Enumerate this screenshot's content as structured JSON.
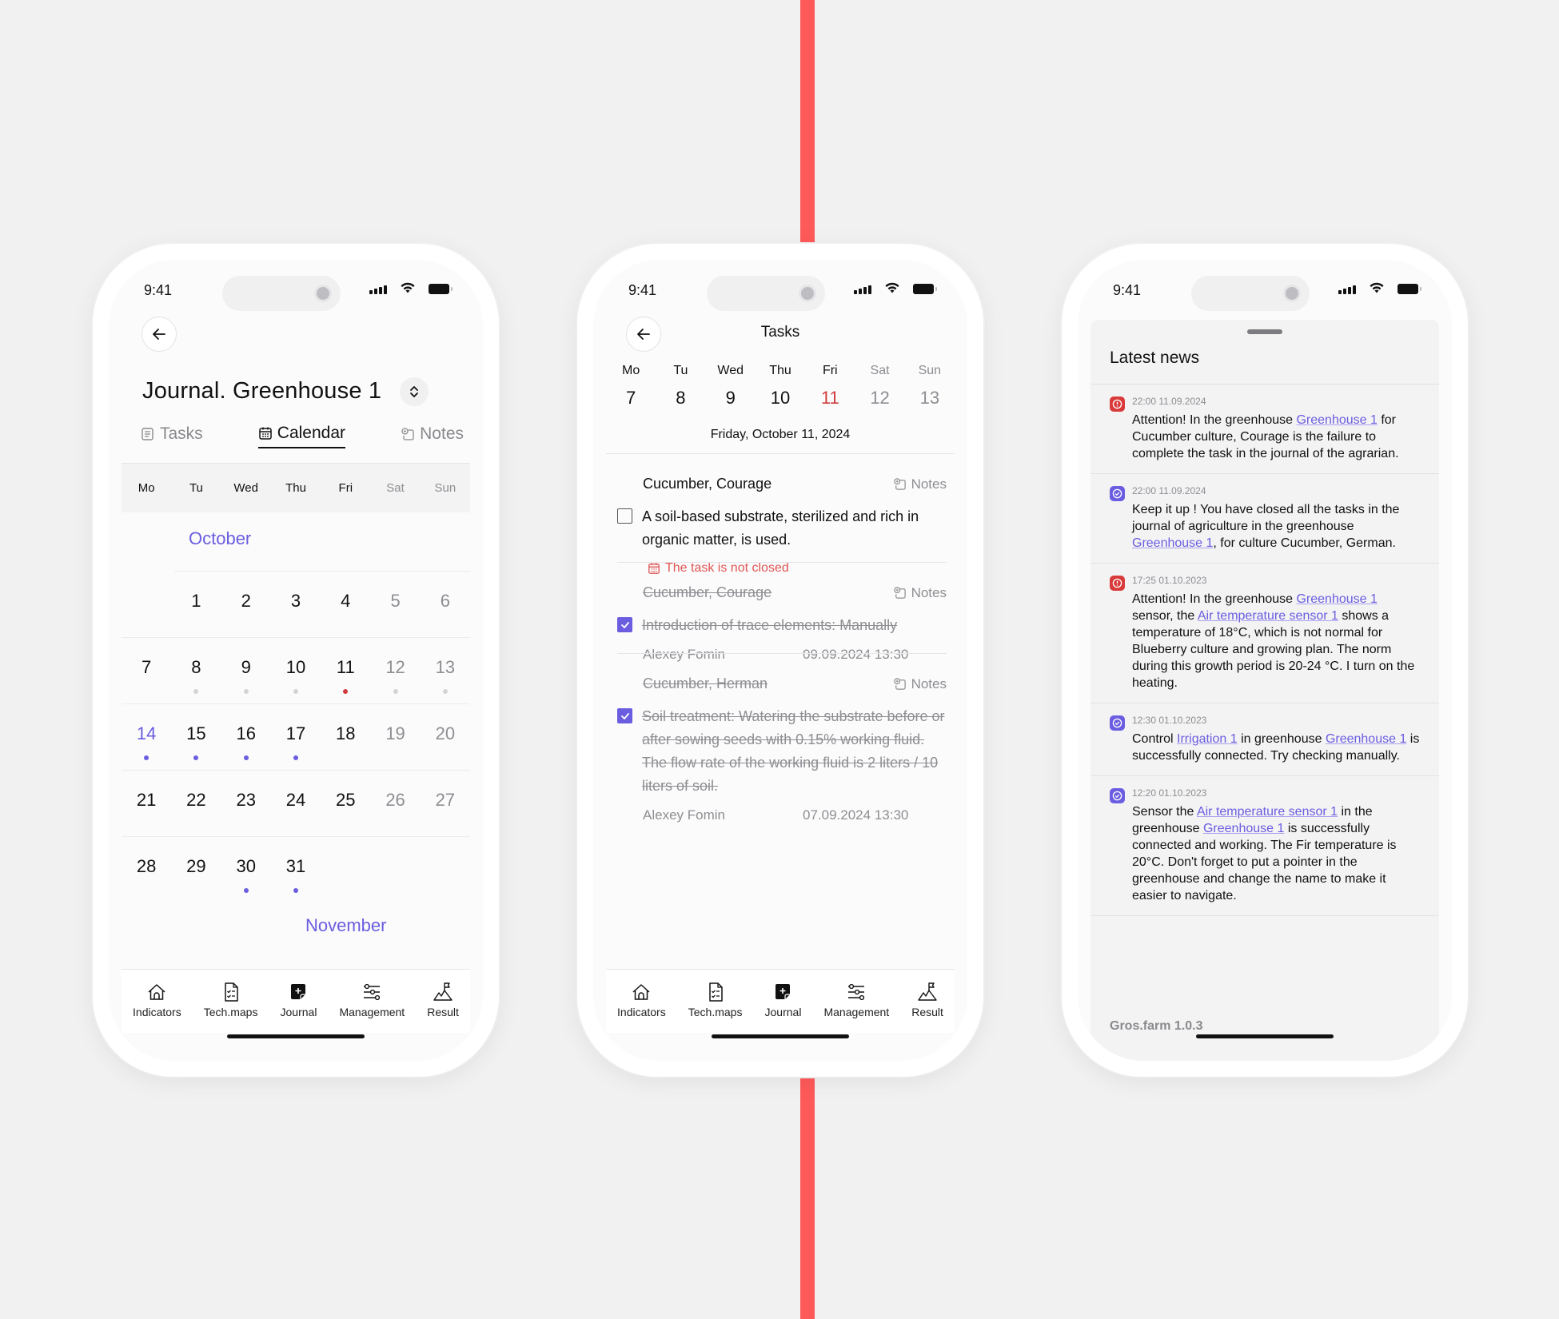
{
  "status_bar": {
    "time": "9:41"
  },
  "phone1": {
    "title": "Journal. Greenhouse 1",
    "tabs": [
      {
        "label": "Tasks",
        "icon": "list-icon",
        "active": false
      },
      {
        "label": "Calendar",
        "icon": "calendar-icon",
        "active": true
      },
      {
        "label": "Notes",
        "icon": "notes-icon",
        "active": false
      }
    ],
    "weekdays": [
      "Mo",
      "Tu",
      "Wed",
      "Thu",
      "Fri",
      "Sat",
      "Sun"
    ],
    "month": "October",
    "next_month": "November",
    "weeks": [
      [
        null,
        1,
        2,
        3,
        4,
        5,
        6
      ],
      [
        7,
        8,
        9,
        10,
        11,
        12,
        13
      ],
      [
        14,
        15,
        16,
        17,
        18,
        19,
        20
      ],
      [
        21,
        22,
        23,
        24,
        25,
        26,
        27
      ],
      [
        28,
        29,
        30,
        31,
        null,
        null,
        null
      ]
    ],
    "today": 14,
    "dots": {
      "8": "gray",
      "9": "gray",
      "10": "gray",
      "11": "red",
      "12": "gray",
      "13": "gray",
      "14": "purple",
      "15": "purple",
      "16": "purple",
      "17": "purple",
      "30": "purple",
      "31": "purple"
    }
  },
  "tabbar": [
    {
      "label": "Indicators",
      "icon": "home-icon"
    },
    {
      "label": "Tech.maps",
      "icon": "document-checklist-icon"
    },
    {
      "label": "Journal",
      "icon": "journal-add-icon"
    },
    {
      "label": "Management",
      "icon": "sliders-icon"
    },
    {
      "label": "Result",
      "icon": "mountain-flag-icon"
    }
  ],
  "phone2": {
    "title": "Tasks",
    "week": [
      {
        "name": "Mo",
        "day": "7"
      },
      {
        "name": "Tu",
        "day": "8"
      },
      {
        "name": "Wed",
        "day": "9"
      },
      {
        "name": "Thu",
        "day": "10"
      },
      {
        "name": "Fri",
        "day": "11",
        "selected": true
      },
      {
        "name": "Sat",
        "day": "12",
        "weekend": true
      },
      {
        "name": "Sun",
        "day": "13",
        "weekend": true
      }
    ],
    "date_label": "Friday, October 11, 2024",
    "notes_label": "Notes",
    "tasks": [
      {
        "culture": "Cucumber, Courage",
        "text": "A soil-based substrate, sterilized and rich in organic matter, is used.",
        "done": false,
        "warning": "The task is not closed"
      },
      {
        "culture": "Cucumber, Courage",
        "text": "Introduction of trace elements: Manually",
        "done": true,
        "author": "Alexey Fomin",
        "datetime": "09.09.2024 13:30"
      },
      {
        "culture": "Cucumber, Herman",
        "text": "Soil treatment: Watering the substrate before or after sowing seeds with 0.15% working fluid. The flow rate of the working fluid is 2 liters / 10 liters of soil.",
        "done": true,
        "author": "Alexey Fomin",
        "datetime": "07.09.2024 13:30"
      }
    ]
  },
  "phone3": {
    "title": "Latest news",
    "news": [
      {
        "type": "alert",
        "timestamp": "22:00 11.09.2024",
        "parts": [
          {
            "t": "Attention! In the greenhouse "
          },
          {
            "link": "Greenhouse 1"
          },
          {
            "t": " for Cucumber culture, Courage is the failure to complete the task in the journal of the agrarian."
          }
        ]
      },
      {
        "type": "ok",
        "timestamp": "22:00 11.09.2024",
        "parts": [
          {
            "t": "Keep it up ! You have closed all the tasks in the journal of agriculture in the greenhouse "
          },
          {
            "link": "Greenhouse 1"
          },
          {
            "t": ", for culture Cucumber, German."
          }
        ]
      },
      {
        "type": "alert",
        "timestamp": "17:25 01.10.2023",
        "parts": [
          {
            "t": "Attention! In the greenhouse "
          },
          {
            "link": "Greenhouse 1"
          },
          {
            "t": " sensor, the "
          },
          {
            "link": "Air temperature sensor 1"
          },
          {
            "t": " shows a temperature of 18°C, which is not normal for Blueberry culture and growing plan. The norm during this growth period is 20-24 °C. I turn on the heating."
          }
        ]
      },
      {
        "type": "ok",
        "timestamp": "12:30 01.10.2023",
        "parts": [
          {
            "t": "Control "
          },
          {
            "link": "Irrigation 1"
          },
          {
            "t": " in greenhouse "
          },
          {
            "link": "Greenhouse 1"
          },
          {
            "t": " is successfully connected. Try checking manually."
          }
        ]
      },
      {
        "type": "ok",
        "timestamp": "12:20 01.10.2023",
        "parts": [
          {
            "t": "Sensor the "
          },
          {
            "link": "Air temperature sensor 1"
          },
          {
            "t": " in the greenhouse "
          },
          {
            "link": "Greenhouse 1"
          },
          {
            "t": " is successfully connected and working. The Fir temperature is 20°C. Don't forget to put a pointer in the greenhouse and change the name to make it easier to navigate."
          }
        ]
      }
    ],
    "footer": "Gros.farm  1.0.3"
  },
  "colors": {
    "accent": "#6b5de0",
    "alert": "#d93a3a",
    "divider_line": "#ff5a5a",
    "background": "#f1f1f2"
  }
}
